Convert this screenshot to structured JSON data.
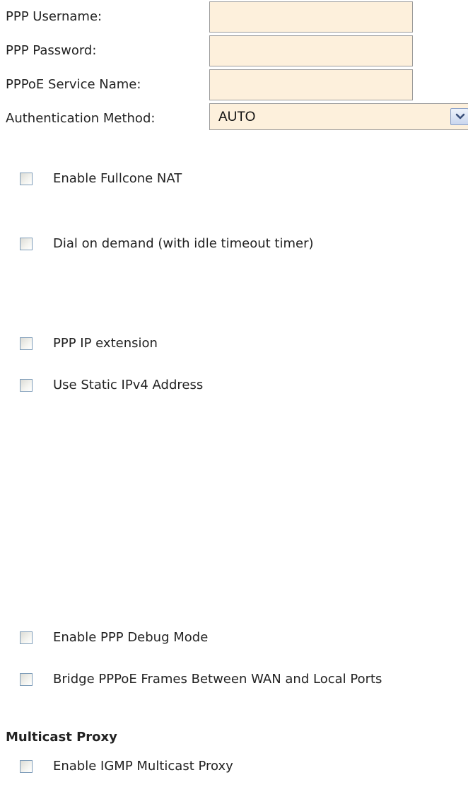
{
  "ppp": {
    "username_label": "PPP Username:",
    "username_value": "",
    "password_label": "PPP Password:",
    "password_value": "",
    "service_name_label": "PPPoE Service Name:",
    "service_name_value": "",
    "auth_label": "Authentication Method:",
    "auth_selected": "AUTO"
  },
  "options": {
    "fullcone_nat": {
      "label": "Enable Fullcone NAT",
      "checked": false
    },
    "dial_on_demand": {
      "label": "Dial on demand (with idle timeout timer)",
      "checked": false
    },
    "ppp_ip_extension": {
      "label": "PPP IP extension",
      "checked": false
    },
    "static_ipv4": {
      "label": "Use Static IPv4 Address",
      "checked": false
    },
    "ppp_debug": {
      "label": "Enable PPP Debug Mode",
      "checked": false
    },
    "bridge_pppoe": {
      "label": "Bridge PPPoE Frames Between WAN and Local Ports",
      "checked": false
    }
  },
  "multicast": {
    "title": "Multicast Proxy",
    "igmp_proxy": {
      "label": "Enable IGMP Multicast Proxy",
      "checked": false
    }
  },
  "icons": {
    "select_arrow": "chevron-down-icon"
  },
  "colors": {
    "input_background": "#fdf0dc",
    "input_border": "#9a9a9a",
    "checkbox_border": "#7f9db9"
  }
}
